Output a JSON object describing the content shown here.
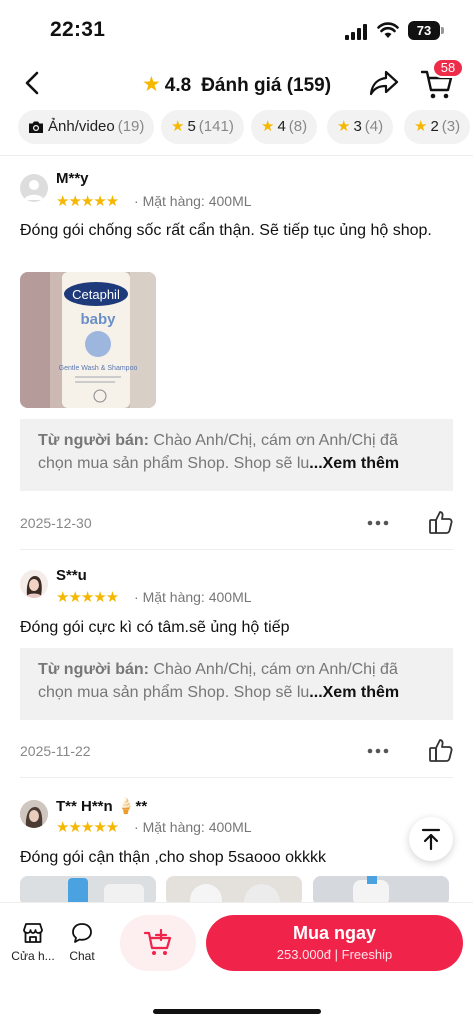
{
  "status_bar": {
    "time": "22:31",
    "battery": "73"
  },
  "header": {
    "rating": "4.8",
    "title": "Đánh giá (159)",
    "cart_badge": "58"
  },
  "filters": [
    {
      "label": "Ảnh/video",
      "count": "(19)"
    },
    {
      "label": "5",
      "count": "(141)"
    },
    {
      "label": "4",
      "count": "(8)"
    },
    {
      "label": "3",
      "count": "(4)"
    },
    {
      "label": "2",
      "count": "(3)"
    }
  ],
  "reviews": [
    {
      "name": "M**y",
      "stars": "★★★★★",
      "variant": "Mặt hàng: 400ML",
      "text": "Đóng gói chống sốc rất cẩn thận. Sẽ tiếp tục ủng hộ shop.",
      "photo_labels": {
        "brand": "Cetaphil",
        "line": "baby",
        "product": "Gentle Wash & Shampoo"
      },
      "seller_prefix": "Từ người bán:",
      "seller_reply": " Chào Anh/Chị, cám ơn Anh/Chị đã chọn mua sản phẩm Shop. Shop sẽ lu",
      "see_more": "...Xem thêm",
      "date": "2025-12-30"
    },
    {
      "name": "S**u",
      "stars": "★★★★★",
      "variant": "Mặt hàng: 400ML",
      "text": "Đóng gói cực kì có tâm.sẽ ủng hộ tiếp",
      "seller_prefix": "Từ người bán:",
      "seller_reply": " Chào Anh/Chị, cám ơn Anh/Chị đã chọn mua sản phẩm Shop. Shop sẽ lu",
      "see_more": "...Xem thêm",
      "date": "2025-11-22"
    },
    {
      "name": "T** H**n 🍦**",
      "stars": "★★★★★",
      "variant": "Mặt hàng: 400ML",
      "text": "Đóng gói cận thận ,cho shop 5saooo okkkk"
    }
  ],
  "bottom_bar": {
    "shop_label": "Cửa h...",
    "chat_label": "Chat",
    "buy_label": "Mua ngay",
    "price": "253.000đ",
    "shipping": "Freeship"
  }
}
